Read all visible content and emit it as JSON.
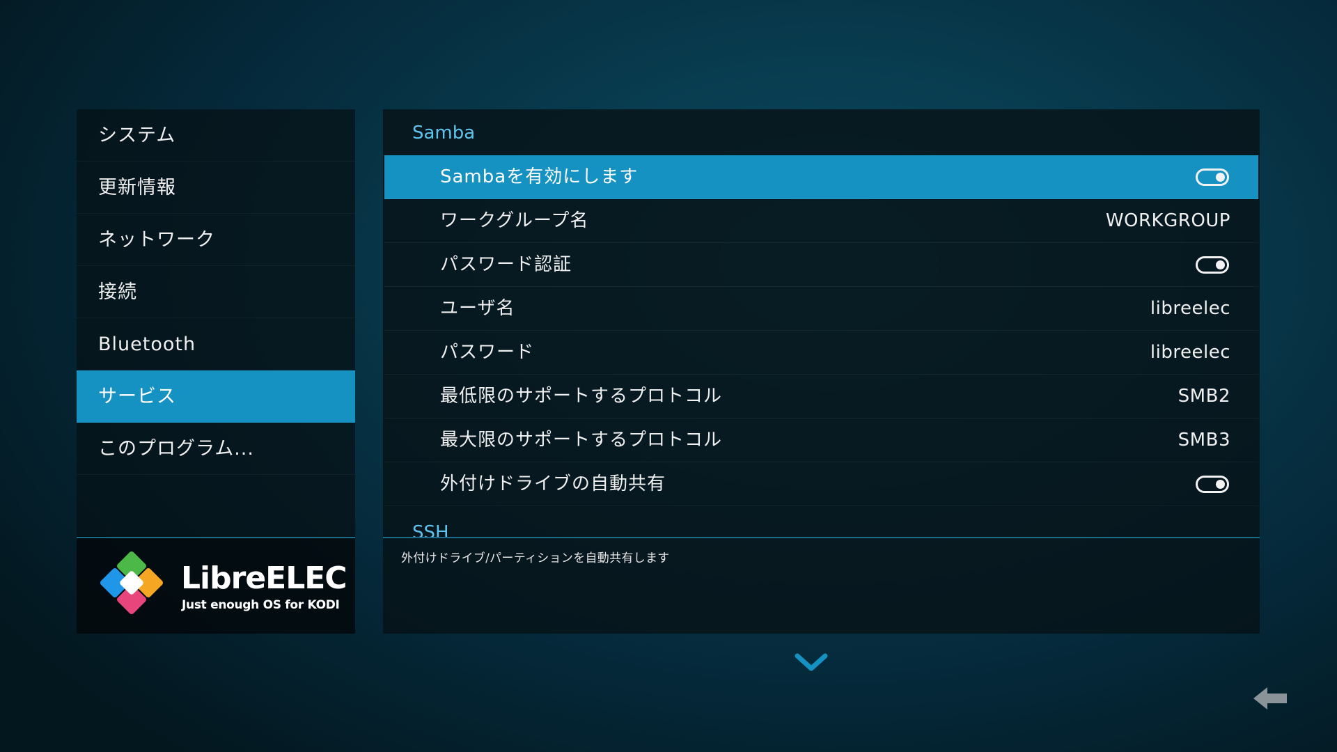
{
  "sidebar": {
    "items": [
      {
        "label": "システム"
      },
      {
        "label": "更新情報"
      },
      {
        "label": "ネットワーク"
      },
      {
        "label": "接続"
      },
      {
        "label": "Bluetooth"
      },
      {
        "label": "サービス"
      },
      {
        "label": "このプログラム..."
      }
    ],
    "active_item": "サービス"
  },
  "logo": {
    "wordmark": "LibreELEC",
    "tagline": "Just enough OS for KODI",
    "colors": [
      "#4cb848",
      "#f5a623",
      "#e8457c",
      "#1f96e8"
    ]
  },
  "main": {
    "sections": [
      {
        "title": "Samba",
        "settings": [
          {
            "label": "Sambaを有効にします",
            "type": "toggle",
            "enabled": true
          },
          {
            "label": "ワークグループ名",
            "type": "value",
            "value": "WORKGROUP"
          },
          {
            "label": "パスワード認証",
            "type": "toggle",
            "enabled": true
          },
          {
            "label": "ユーザ名",
            "type": "value",
            "value": "libreelec"
          },
          {
            "label": "パスワード",
            "type": "value",
            "value": "libreelec"
          },
          {
            "label": "最低限のサポートするプロトコル",
            "type": "value",
            "value": "SMB2"
          },
          {
            "label": "最大限のサポートするプロトコル",
            "type": "value",
            "value": "SMB3"
          },
          {
            "label": "外付けドライブの自動共有",
            "type": "toggle",
            "enabled": true
          }
        ]
      },
      {
        "title": "SSH"
      }
    ],
    "focused_setting": "Sambaを有効にします"
  },
  "description": {
    "text": "外付けドライブ/パーティションを自動共有します"
  },
  "navigation": {
    "scroll_down_icon": "chevron-down-icon",
    "back_icon": "back-arrow-icon"
  },
  "colors": {
    "accent": "#1592c2",
    "section_header": "#5fc4ee",
    "panel_bg": "#071217"
  }
}
